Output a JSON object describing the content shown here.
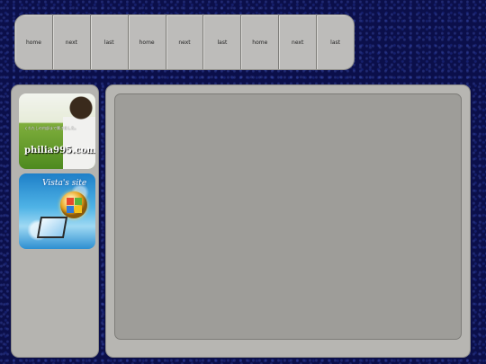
{
  "nav": {
    "items": [
      {
        "label": "home"
      },
      {
        "label": "next"
      },
      {
        "label": "last"
      },
      {
        "label": "home"
      },
      {
        "label": "next"
      },
      {
        "label": "last"
      },
      {
        "label": "home"
      },
      {
        "label": "next"
      },
      {
        "label": "last"
      }
    ]
  },
  "sidebar": {
    "banners": [
      {
        "name": "philia-banner",
        "caption": "くわたしの内部まで響きました。",
        "site": "philia995.com"
      },
      {
        "name": "vista-banner",
        "title": "Vista's site",
        "icon": "windows-logo-icon"
      }
    ]
  },
  "colors": {
    "background": "#0b0f4a",
    "panel": "#b7b6b2",
    "content_inner": "#9e9d99"
  }
}
